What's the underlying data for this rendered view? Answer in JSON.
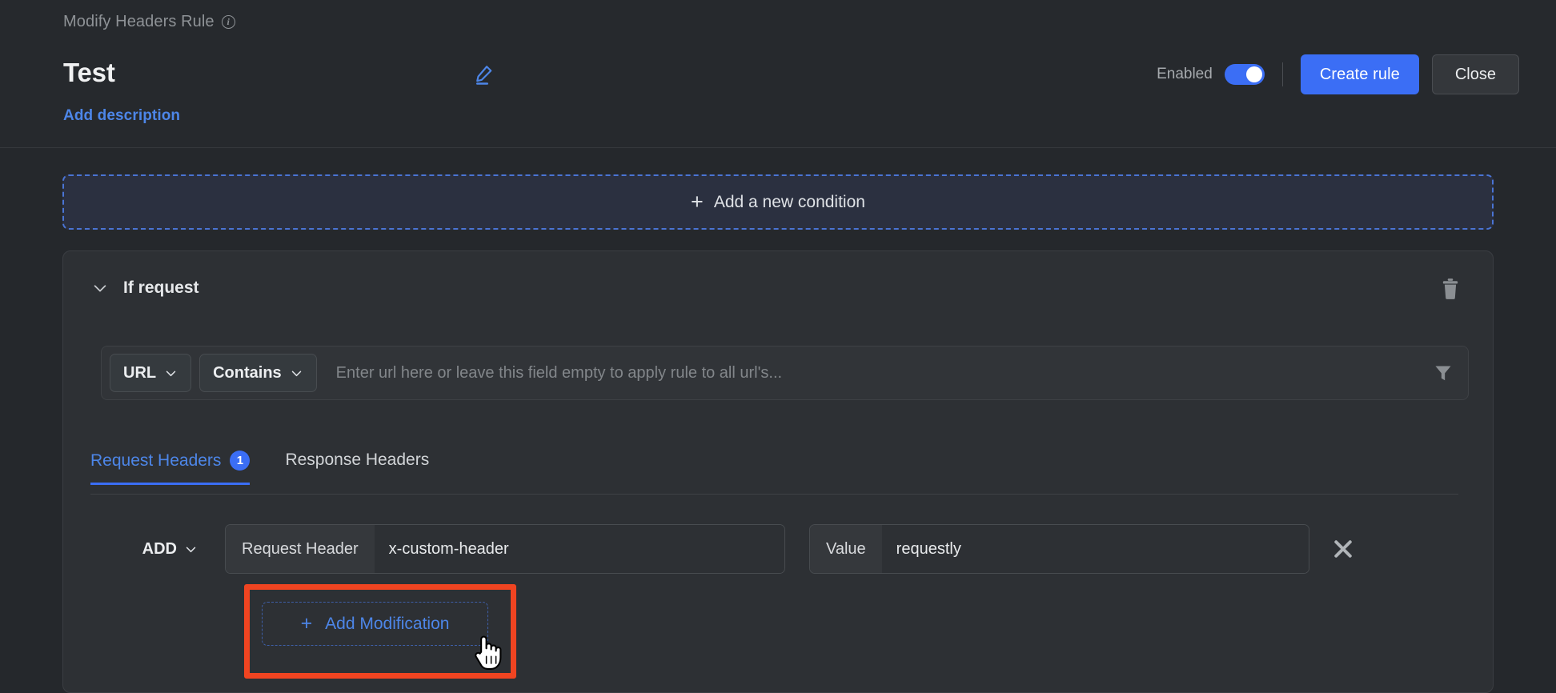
{
  "header": {
    "breadcrumb": "Modify Headers Rule",
    "info_icon": "info-icon",
    "rule_title": "Test",
    "edit_icon": "edit-pencil-icon",
    "add_description": "Add description",
    "enabled_label": "Enabled",
    "enabled_state": "on",
    "create_rule_label": "Create rule",
    "close_label": "Close"
  },
  "condition": {
    "add_condition_plus": "+",
    "add_condition_label": "Add a new condition"
  },
  "rule_card": {
    "section_title": "If request",
    "chevron_icon": "chevron-down-icon",
    "delete_icon": "trash-icon",
    "url_condition": {
      "source_key": "URL",
      "operator": "Contains",
      "value": "",
      "placeholder": "Enter url here or leave this field empty to apply rule to all url's...",
      "filter_icon": "funnel-icon"
    },
    "tabs": [
      {
        "label": "Request Headers",
        "badge": "1",
        "active": true
      },
      {
        "label": "Response Headers",
        "badge": "",
        "active": false
      }
    ],
    "modifications": [
      {
        "action": "ADD",
        "header_label": "Request Header",
        "header_value": "x-custom-header",
        "header_placeholder": "",
        "value_label": "Value",
        "value_value": "requestly",
        "value_placeholder": "",
        "remove_icon": "close-x-icon"
      }
    ],
    "add_modification_plus": "+",
    "add_modification_label": "Add Modification"
  },
  "annotation": {
    "highlight_color": "#f04421",
    "cursor_icon": "hand-pointer-cursor"
  },
  "colors": {
    "background": "#25282c",
    "card": "#2d3034",
    "accent_blue": "#3b6ef5",
    "link_blue": "#4d86e8",
    "condition_box_bg": "#2b3040",
    "highlight_red": "#f04421"
  }
}
